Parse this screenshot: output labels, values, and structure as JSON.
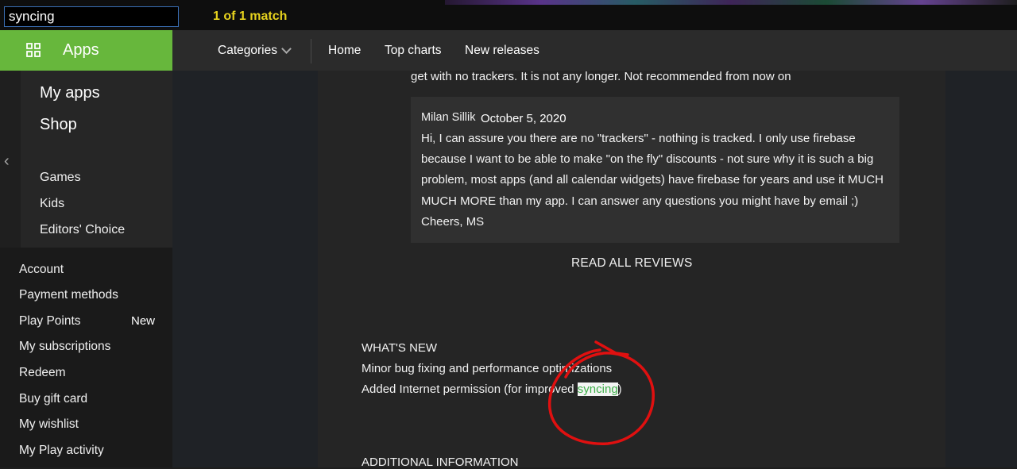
{
  "find": {
    "query": "syncing",
    "count": "1 of 1 match"
  },
  "sidebar": {
    "apps_label": "Apps",
    "primary": [
      "My apps",
      "Shop"
    ],
    "categories": [
      "Games",
      "Kids",
      "Editors' Choice"
    ],
    "account": [
      "Account",
      "Payment methods",
      "Play Points",
      "My subscriptions",
      "Redeem",
      "Buy gift card",
      "My wishlist",
      "My Play activity"
    ],
    "new_badge": "New"
  },
  "topnav": {
    "categories": "Categories",
    "home": "Home",
    "top_charts": "Top charts",
    "new_releases": "New releases"
  },
  "review": {
    "tail": "get with no trackers. It is not any longer. Not recommended from now on",
    "reply_author": "Milan Sillik",
    "reply_date": "October 5, 2020",
    "reply_text": "Hi, I can assure you there are no \"trackers\" - nothing is tracked. I only use firebase because I want to be able to make \"on the fly\" discounts - not sure why it is such a big problem, most apps (and all calendar widgets) have firebase for years and use it MUCH MUCH MORE than my app. I can answer any questions you might have by email ;) Cheers, MS",
    "read_all": "READ ALL REVIEWS"
  },
  "whats_new": {
    "title": "WHAT'S NEW",
    "line1": "Minor bug fixing and performance optimizations",
    "line2_prefix": "Added Internet permission (for improved ",
    "line2_match": "syncing",
    "line2_suffix": ")"
  },
  "additional_info": "ADDITIONAL INFORMATION",
  "colors": {
    "apps_green": "#67b73c",
    "find_count": "#e6d21e",
    "annotation_red": "#e01010",
    "match_text": "#3fae4a"
  }
}
